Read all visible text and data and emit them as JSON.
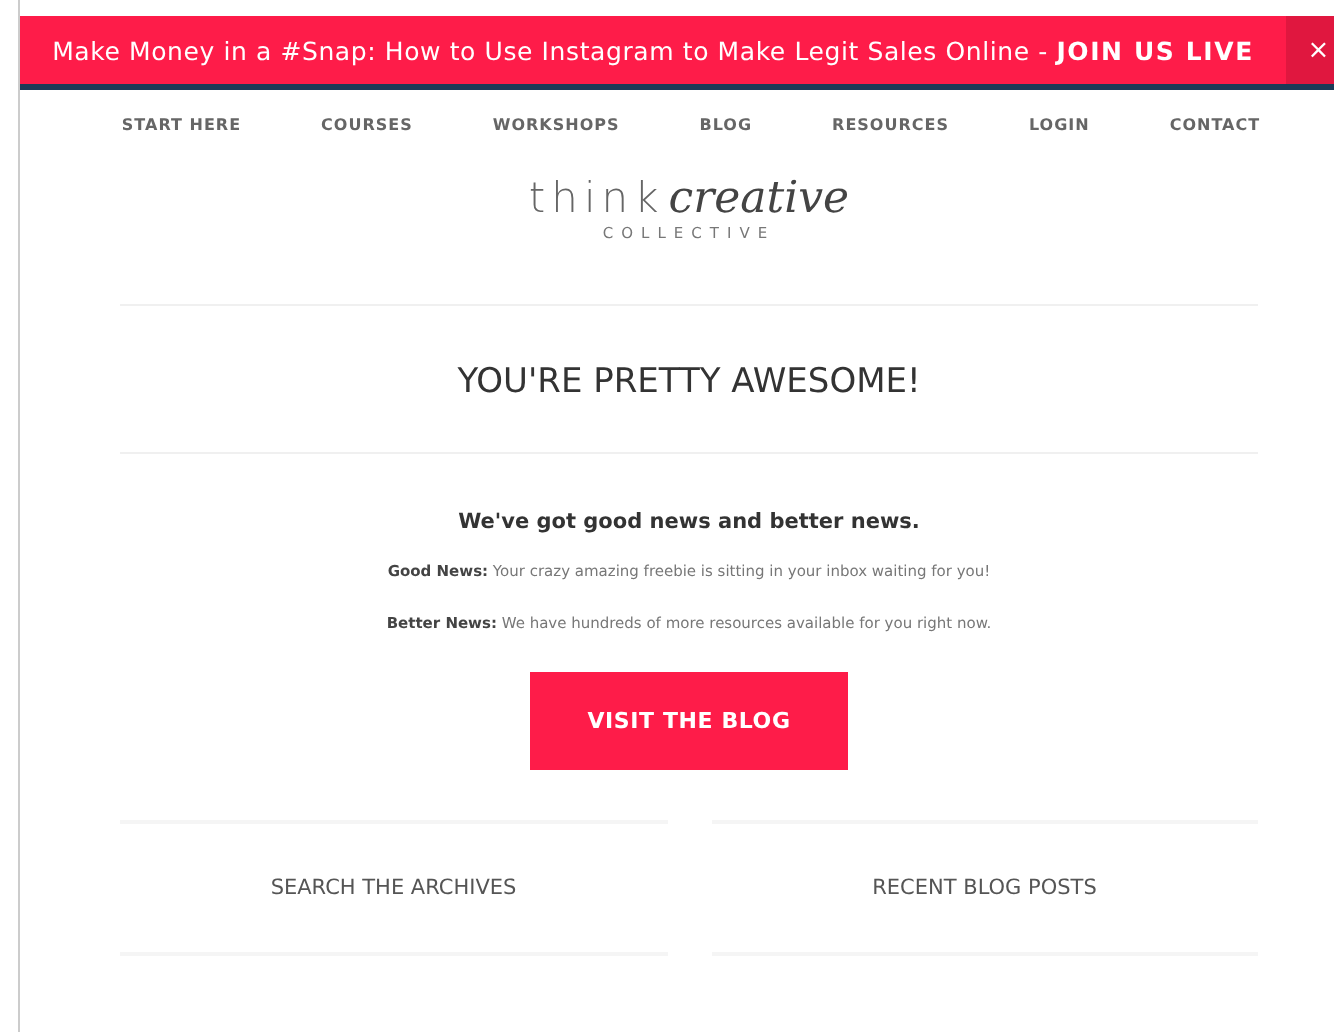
{
  "banner": {
    "text": "Make Money in a #Snap: How to Use Instagram to Make Legit Sales Online - ",
    "link": "JOIN US LIVE",
    "close": "×"
  },
  "nav": [
    "START HERE",
    "COURSES",
    "WORKSHOPS",
    "BLOG",
    "RESOURCES",
    "LOGIN",
    "CONTACT"
  ],
  "logo": {
    "word_1": "think",
    "word_2": "creative",
    "tagline": "COLLECTIVE"
  },
  "heading": "YOU'RE PRETTY AWESOME!",
  "subheading": "We've got good news and better news.",
  "paragraphs": [
    "**Good News:** Your crazy amazing freebie is sitting in your inbox waiting for you!",
    "**Better News:** We have hundreds of more resources available for you right now."
  ],
  "button": "VISIT THE BLOG",
  "widgets": [
    "SEARCH THE ARCHIVES",
    "RECENT BLOG POSTS"
  ]
}
